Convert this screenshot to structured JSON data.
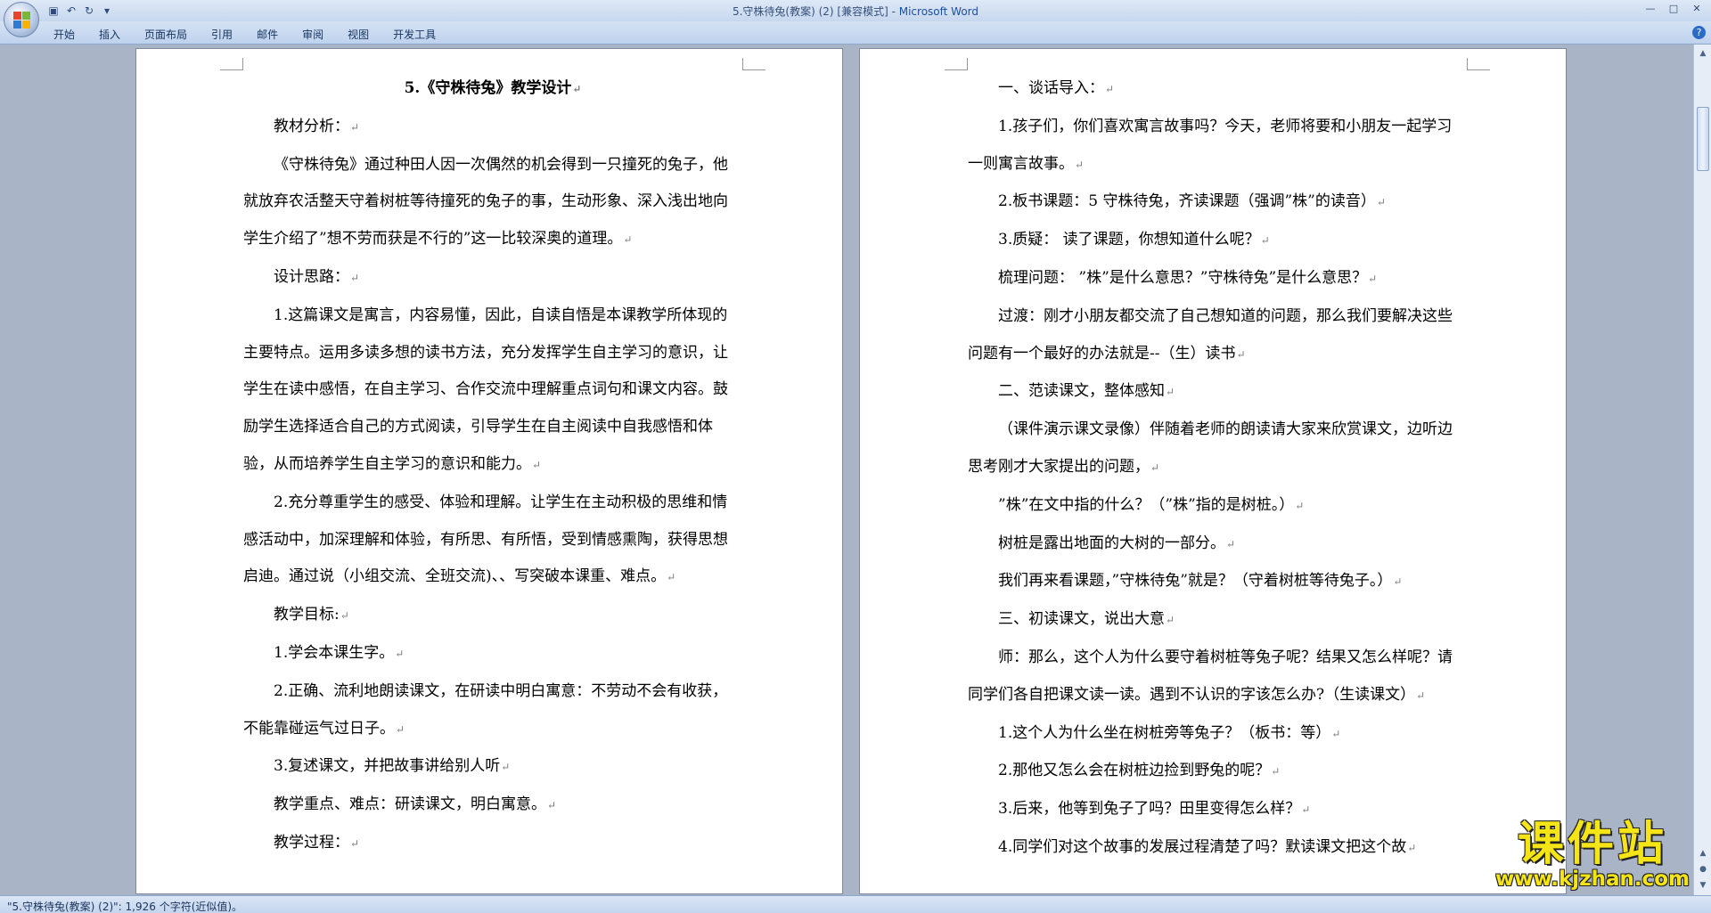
{
  "window": {
    "title_doc": "5.守株待兔(教案) (2) [兼容模式] - ",
    "title_app": "Microsoft Word"
  },
  "quick_access": {
    "save_icon": "save-icon",
    "undo_icon": "undo-icon",
    "redo_icon": "redo-icon",
    "customize_icon": "dropdown-icon"
  },
  "ribbon": {
    "tabs": [
      "开始",
      "插入",
      "页面布局",
      "引用",
      "邮件",
      "审阅",
      "视图",
      "开发工具"
    ],
    "help_label": "?"
  },
  "left_page": {
    "title": "5.《守株待兔》教学设计",
    "paragraphs": [
      "教材分析：",
      "《守株待兔》通过种田人因一次偶然的机会得到一只撞死的兔子，他就放弃农活整天守着树桩等待撞死的兔子的事，生动形象、深入浅出地向学生介绍了”想不劳而获是不行的”这一比较深奥的道理。",
      "设计思路：",
      "1.这篇课文是寓言，内容易懂，因此，自读自悟是本课教学所体现的主要特点。运用多读多想的读书方法，充分发挥学生自主学习的意识，让学生在读中感悟，在自主学习、合作交流中理解重点词句和课文内容。鼓励学生选择适合自己的方式阅读，引导学生在自主阅读中自我感悟和体验，从而培养学生自主学习的意识和能力。",
      "2.充分尊重学生的感受、体验和理解。让学生在主动积极的思维和情感活动中，加深理解和体验，有所思、有所悟，受到情感熏陶，获得思想启迪。通过说（小组交流、全班交流)、、写突破本课重、难点。",
      "教学目标:",
      "1.学会本课生字。",
      "2.正确、流利地朗读课文，在研读中明白寓意：不劳动不会有收获，不能靠碰运气过日子。",
      "3.复述课文，并把故事讲给别人听",
      "教学重点、难点：研读课文，明白寓意。",
      "教学过程："
    ]
  },
  "right_page": {
    "paragraphs": [
      "一、谈话导入：",
      "1.孩子们，你们喜欢寓言故事吗？今天，老师将要和小朋友一起学习一则寓言故事。",
      "2.板书课题：5 守株待兔，齐读课题（强调”株”的读音）",
      "3.质疑：  读了课题，你想知道什么呢？",
      "梳理问题：  ”株”是什么意思？”守株待兔”是什么意思？",
      "过渡：刚才小朋友都交流了自己想知道的问题，那么我们要解决这些问题有一个最好的办法就是--（生）读书",
      "二、范读课文，整体感知",
      "（课件演示课文录像）伴随着老师的朗读请大家来欣赏课文，边听边思考刚才大家提出的问题，",
      "”株”在文中指的什么？（”株”指的是树桩。）",
      "树桩是露出地面的大树的一部分。",
      "我们再来看课题，”守株待兔”就是？（守着树桩等待兔子。）",
      "三、初读课文，说出大意",
      "师：那么，这个人为什么要守着树桩等兔子呢？结果又怎么样呢？请同学们各自把课文读一读。遇到不认识的字该怎么办?（生读课文）",
      "1.这个人为什么坐在树桩旁等兔子？（板书：等）",
      "2.那他又怎么会在树桩边捡到野兔的呢？",
      "3.后来，他等到兔子了吗？田里变得怎么样？",
      "4.同学们对这个故事的发展过程清楚了吗？默读课文把这个故"
    ]
  },
  "paragraph_mark": "↵",
  "status_bar": {
    "text": "\"5.守株待兔(教案) (2)\": 1,926 个字符(近似值)。"
  },
  "watermark": {
    "main": "课件站",
    "url": "www.kjzhan.com"
  },
  "colors": {
    "ribbon_bg": "#c7d7ee",
    "canvas_bg": "#a9b4c6",
    "watermark_yellow": "#f5e416"
  }
}
